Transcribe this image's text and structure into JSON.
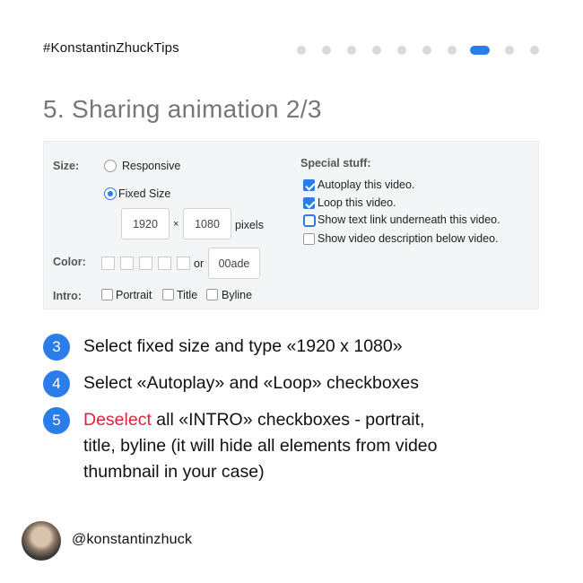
{
  "header": {
    "hashtag": "#KonstantinZhuckTips",
    "pager": {
      "total": 10,
      "active_index": 7
    }
  },
  "title": "5. Sharing animation 2/3",
  "panel": {
    "size_label": "Size:",
    "responsive_label": "Responsive",
    "fixed_size_label": "Fixed Size",
    "selected_size_option": "Fixed Size",
    "width_value": "1920",
    "times": "×",
    "height_value": "1080",
    "units": "pixels",
    "color_label": "Color:",
    "or_label": "or",
    "color_value": "00ade",
    "intro_label": "Intro:",
    "intro_options": [
      "Portrait",
      "Title",
      "Byline"
    ],
    "special_label": "Special stuff:",
    "special_options": [
      {
        "label": "Autoplay this video.",
        "checked": true
      },
      {
        "label": "Loop this video.",
        "checked": true
      },
      {
        "label": "Show text link underneath this video.",
        "checked": false
      },
      {
        "label": "Show video description below video.",
        "checked": false
      }
    ]
  },
  "steps": [
    {
      "number": "3",
      "text": "Select fixed size and type «1920 x 1080»"
    },
    {
      "number": "4",
      "text": "Select «Autoplay» and «Loop» checkboxes"
    },
    {
      "number": "5",
      "highlight": "Deselect",
      "line1": " all «INTRO» checkboxes - portrait,",
      "line2": "title, byline (it will hide all elements from video",
      "line3": "thumbnail in your case)"
    }
  ],
  "footer": {
    "handle": "@konstantinzhuck"
  },
  "colors": {
    "accent": "#2b7de9",
    "highlight": "#e0223a",
    "title_gray": "#777777"
  }
}
